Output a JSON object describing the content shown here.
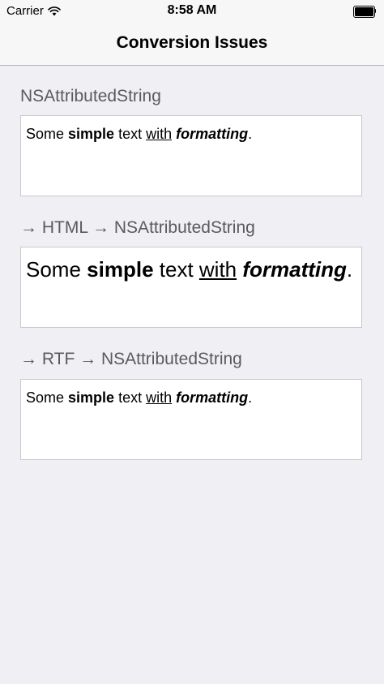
{
  "status_bar": {
    "carrier": "Carrier",
    "time": "8:58 AM"
  },
  "nav": {
    "title": "Conversion Issues"
  },
  "sections": [
    {
      "label": "NSAttributedString",
      "text": {
        "w1": "Some ",
        "w2": "simple",
        "w3": " text ",
        "w4": "with",
        "w5": " ",
        "w6": "formatting",
        "w7": "."
      }
    },
    {
      "label": "→ HTML → NSAttributedString",
      "text": {
        "w1": "Some ",
        "w2": "simple",
        "w3": " text ",
        "w4": "with",
        "w5": " ",
        "w6": "formatting",
        "w7": "."
      }
    },
    {
      "label": "→ RTF → NSAttributedString",
      "text": {
        "w1": "Some ",
        "w2": "simple",
        "w3": " text ",
        "w4": "with",
        "w5": " ",
        "w6": "formatting",
        "w7": "."
      }
    }
  ],
  "colors": {
    "background": "#efeff4",
    "nav_background": "#f7f7f7",
    "label_gray": "#5a5a5f"
  }
}
